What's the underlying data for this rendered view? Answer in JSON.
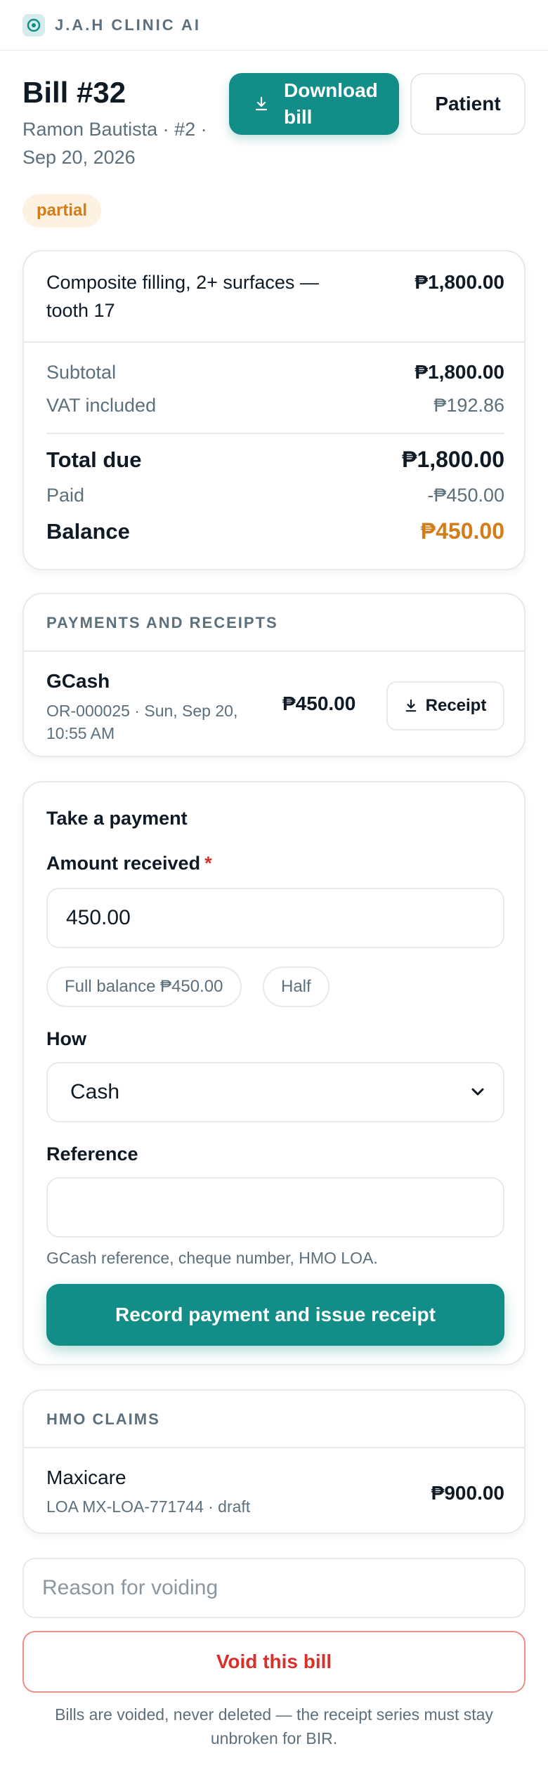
{
  "app": {
    "brand": "J.A.H CLINIC AI"
  },
  "bill": {
    "title": "Bill #32",
    "subtitle": "Ramon Bautista · #2 · Sep 20, 2026",
    "status": "partial",
    "download_label": "Download bill",
    "patient_label": "Patient"
  },
  "items": [
    {
      "description": "Composite filling, 2+ surfaces — tooth 17",
      "amount": "₱1,800.00"
    }
  ],
  "totals": {
    "subtotal_label": "Subtotal",
    "subtotal": "₱1,800.00",
    "vat_label": "VAT included",
    "vat": "₱192.86",
    "total_label": "Total due",
    "total": "₱1,800.00",
    "paid_label": "Paid",
    "paid": "-₱450.00",
    "balance_label": "Balance",
    "balance": "₱450.00"
  },
  "payments": {
    "heading": "PAYMENTS AND RECEIPTS",
    "list": [
      {
        "method": "GCash",
        "meta": "OR-000025 · Sun, Sep 20, 10:55 AM",
        "amount": "₱450.00",
        "receipt_label": "Receipt"
      }
    ]
  },
  "payment_form": {
    "heading": "Take a payment",
    "amount_label": "Amount received",
    "required_mark": "*",
    "amount_value": "450.00",
    "chip_full": "Full balance ₱450.00",
    "chip_half": "Half",
    "how_label": "How",
    "how_value": "Cash",
    "reference_label": "Reference",
    "reference_value": "",
    "reference_hint": "GCash reference, cheque number, HMO LOA.",
    "submit_label": "Record payment and issue receipt"
  },
  "hmo": {
    "heading": "HMO CLAIMS",
    "list": [
      {
        "provider": "Maxicare",
        "meta": "LOA MX-LOA-771744 · draft",
        "amount": "₱900.00"
      }
    ]
  },
  "void": {
    "placeholder": "Reason for voiding",
    "button_label": "Void this bill",
    "note": "Bills are voided, never deleted — the receipt series must stay unbroken for BIR."
  },
  "colors": {
    "accent": "#128d87",
    "warning": "#d47c18",
    "danger": "#d9302c"
  }
}
